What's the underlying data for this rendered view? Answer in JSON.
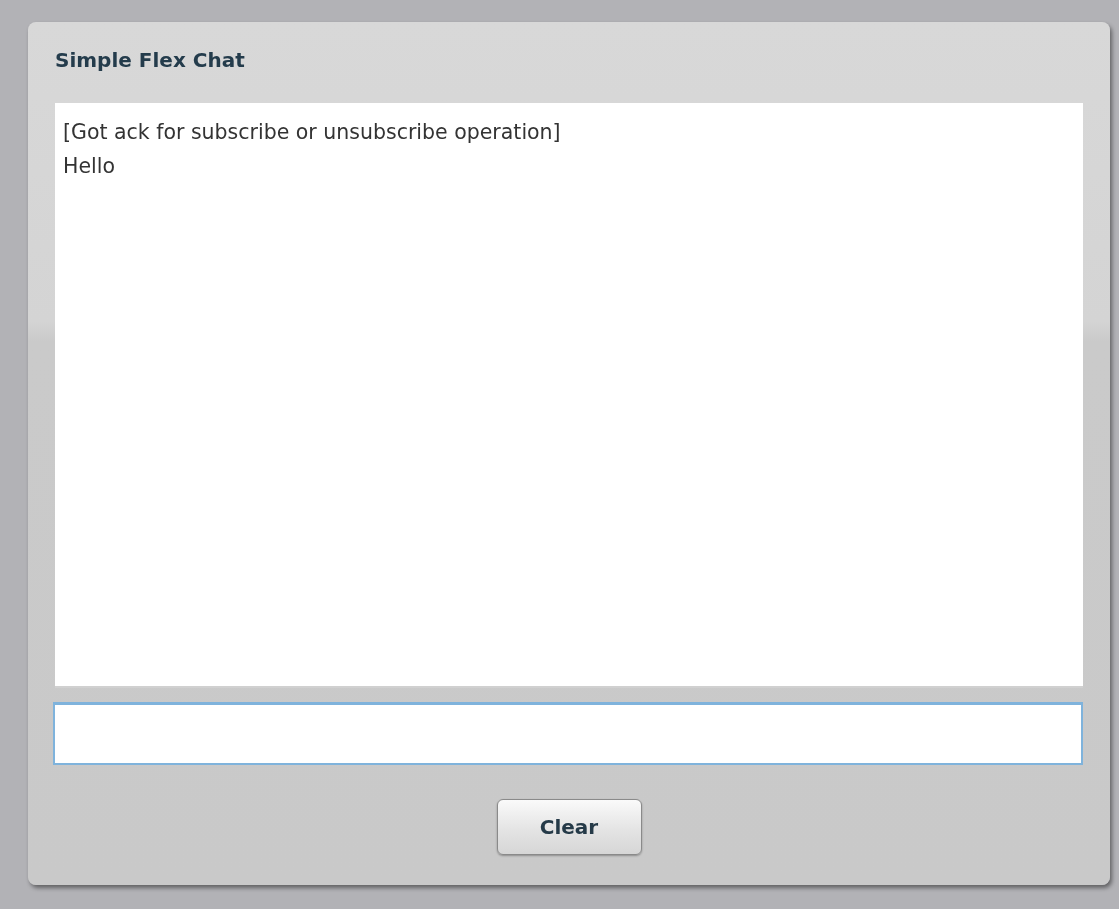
{
  "panel": {
    "title": "Simple Flex Chat"
  },
  "messages": [
    "[Got ack for subscribe or unsubscribe operation]",
    "Hello"
  ],
  "buttons": [
    "Clear"
  ]
}
